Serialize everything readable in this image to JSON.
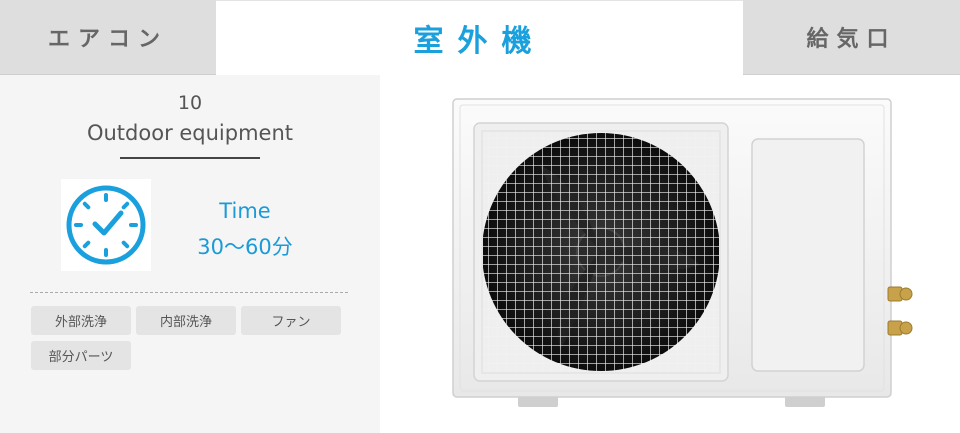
{
  "tabs": {
    "left": "エアコン",
    "center": "室外機",
    "right": "給気口"
  },
  "step": {
    "number": "10",
    "title": "Outdoor equipment"
  },
  "time": {
    "label": "Time",
    "value": "30〜60分"
  },
  "tags": [
    "外部洗浄",
    "内部洗浄",
    "ファン",
    "部分パーツ"
  ],
  "colors": {
    "accent": "#1aa0dc",
    "tab_inactive_bg": "#dedede",
    "panel_bg": "#f5f5f5",
    "tag_bg": "#e4e4e4"
  },
  "icons": {
    "clock": "clock-icon"
  },
  "image": {
    "subject": "outdoor-unit"
  }
}
